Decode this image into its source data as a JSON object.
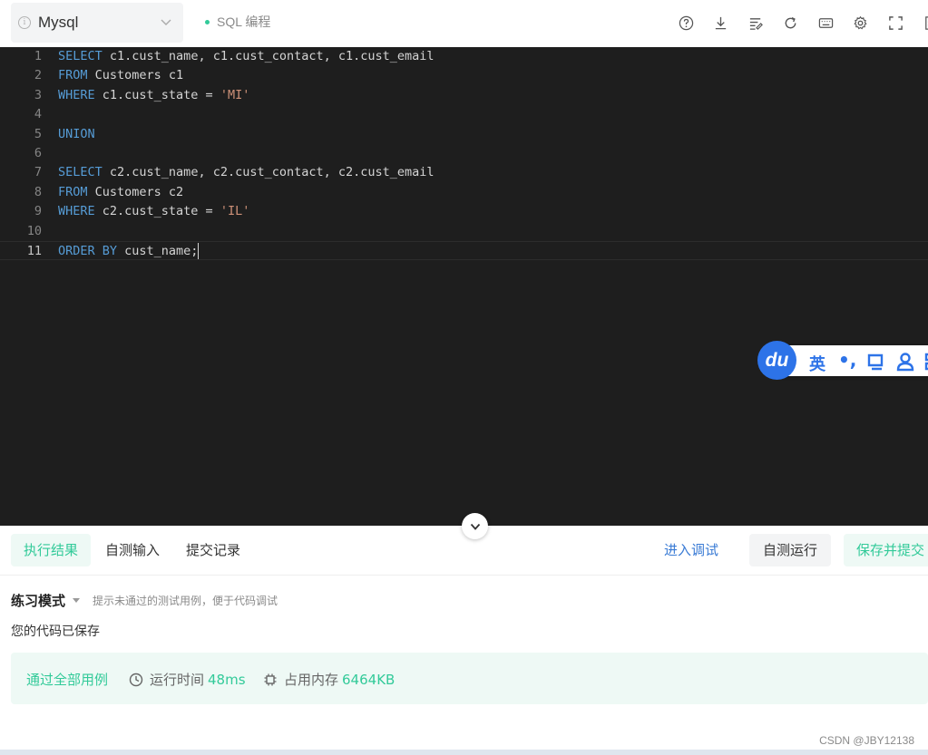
{
  "toolbar": {
    "language": "Mysql",
    "mode_tag": "SQL 编程",
    "icons": [
      "help-icon",
      "download-icon",
      "format-icon",
      "reset-icon",
      "keyboard-icon",
      "settings-icon",
      "fullscreen-icon",
      "close-panel-icon"
    ]
  },
  "editor": {
    "active_line": 11,
    "lines": [
      {
        "no": "1",
        "tokens": [
          {
            "t": "SELECT",
            "k": "kw"
          },
          {
            "t": " c1.cust_name, c1.cust_contact, c1.cust_email",
            "k": ""
          }
        ]
      },
      {
        "no": "2",
        "tokens": [
          {
            "t": "FROM",
            "k": "kw"
          },
          {
            "t": " Customers c1",
            "k": ""
          }
        ]
      },
      {
        "no": "3",
        "tokens": [
          {
            "t": "WHERE",
            "k": "kw"
          },
          {
            "t": " c1.cust_state = ",
            "k": ""
          },
          {
            "t": "'MI'",
            "k": "str"
          }
        ]
      },
      {
        "no": "4",
        "tokens": []
      },
      {
        "no": "5",
        "tokens": [
          {
            "t": "UNION",
            "k": "kw"
          }
        ]
      },
      {
        "no": "6",
        "tokens": []
      },
      {
        "no": "7",
        "tokens": [
          {
            "t": "SELECT",
            "k": "kw"
          },
          {
            "t": " c2.cust_name, c2.cust_contact, c2.cust_email",
            "k": ""
          }
        ]
      },
      {
        "no": "8",
        "tokens": [
          {
            "t": "FROM",
            "k": "kw"
          },
          {
            "t": " Customers c2",
            "k": ""
          }
        ]
      },
      {
        "no": "9",
        "tokens": [
          {
            "t": "WHERE",
            "k": "kw"
          },
          {
            "t": " c2.cust_state = ",
            "k": ""
          },
          {
            "t": "'IL'",
            "k": "str"
          }
        ]
      },
      {
        "no": "10",
        "tokens": []
      },
      {
        "no": "11",
        "tokens": [
          {
            "t": "ORDER BY",
            "k": "kw"
          },
          {
            "t": " cust_name;",
            "k": ""
          }
        ]
      }
    ]
  },
  "ime": {
    "logo": "du",
    "mode": "英",
    "punct": "•,"
  },
  "tabs": [
    {
      "label": "执行结果",
      "active": true
    },
    {
      "label": "自测输入",
      "active": false
    },
    {
      "label": "提交记录",
      "active": false
    }
  ],
  "actions": {
    "debug": "进入调试",
    "run": "自测运行",
    "submit": "保存并提交"
  },
  "result": {
    "mode_name": "练习模式",
    "mode_hint": "提示未通过的测试用例，便于代码调试",
    "saved_message": "您的代码已保存",
    "pass_text": "通过全部用例",
    "time_label": "运行时间",
    "time_value": "48ms",
    "memory_label": "占用内存",
    "memory_value": "6464KB"
  },
  "watermark": "CSDN @JBY12138",
  "colors": {
    "accent_green": "#32ca99",
    "link_blue": "#3a7bd5",
    "editor_bg": "#1e1e1e",
    "keyword": "#569cd6",
    "string": "#ce9178"
  }
}
